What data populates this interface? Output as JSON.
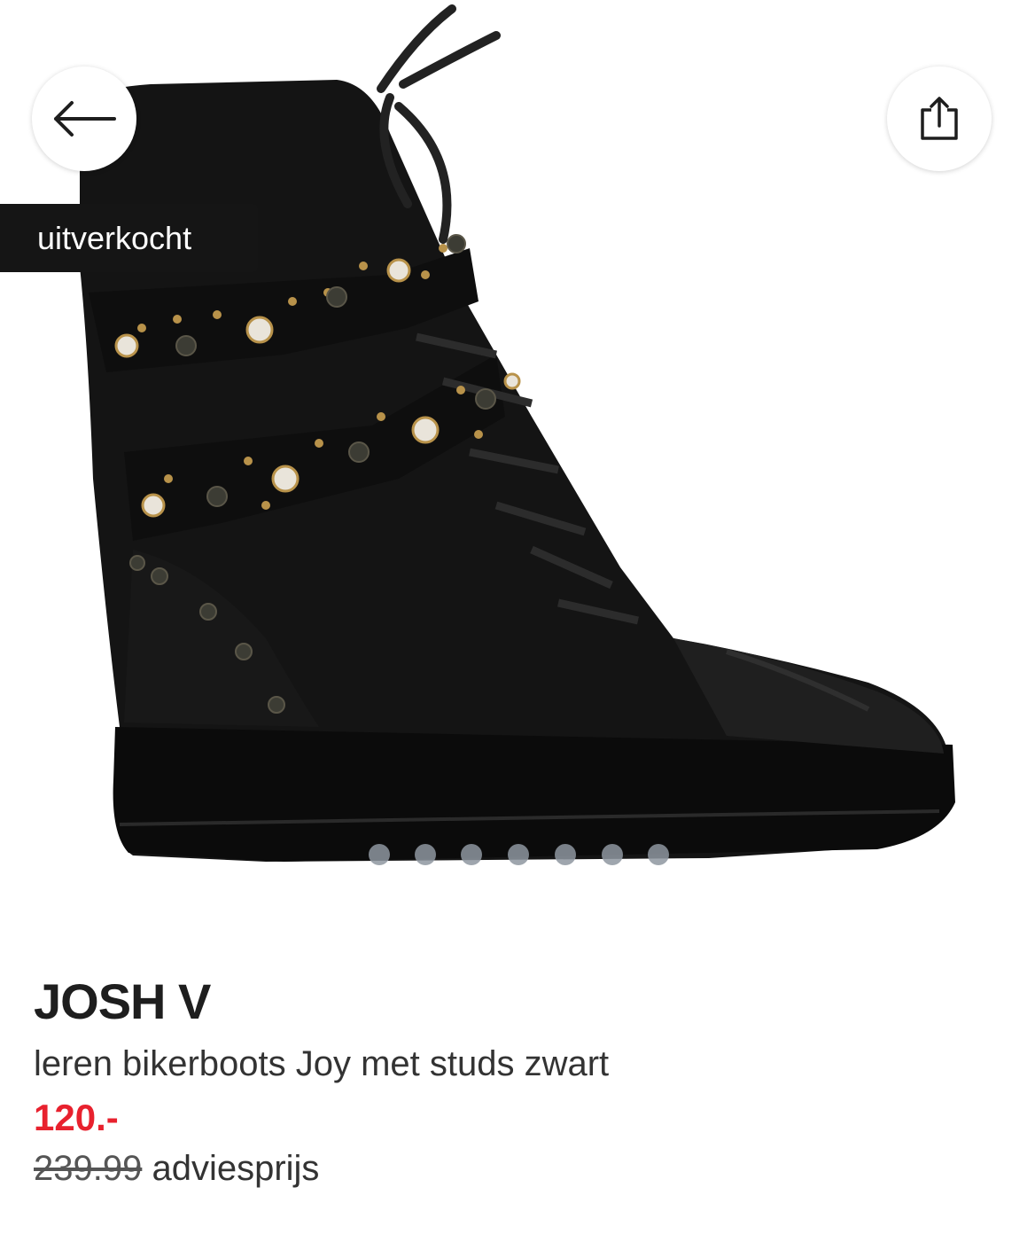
{
  "badge": {
    "text": "uitverkocht"
  },
  "gallery": {
    "image_count": 7,
    "active_index": 0
  },
  "product": {
    "brand": "JOSH V",
    "description": "leren bikerboots Joy met studs zwart",
    "price": "120.-",
    "old_price": "239.99",
    "old_price_label": "adviesprijs"
  },
  "colors": {
    "price": "#e8212e",
    "badge_bg": "#151515"
  },
  "icons": {
    "back": "arrow-left-icon",
    "share": "share-icon"
  }
}
